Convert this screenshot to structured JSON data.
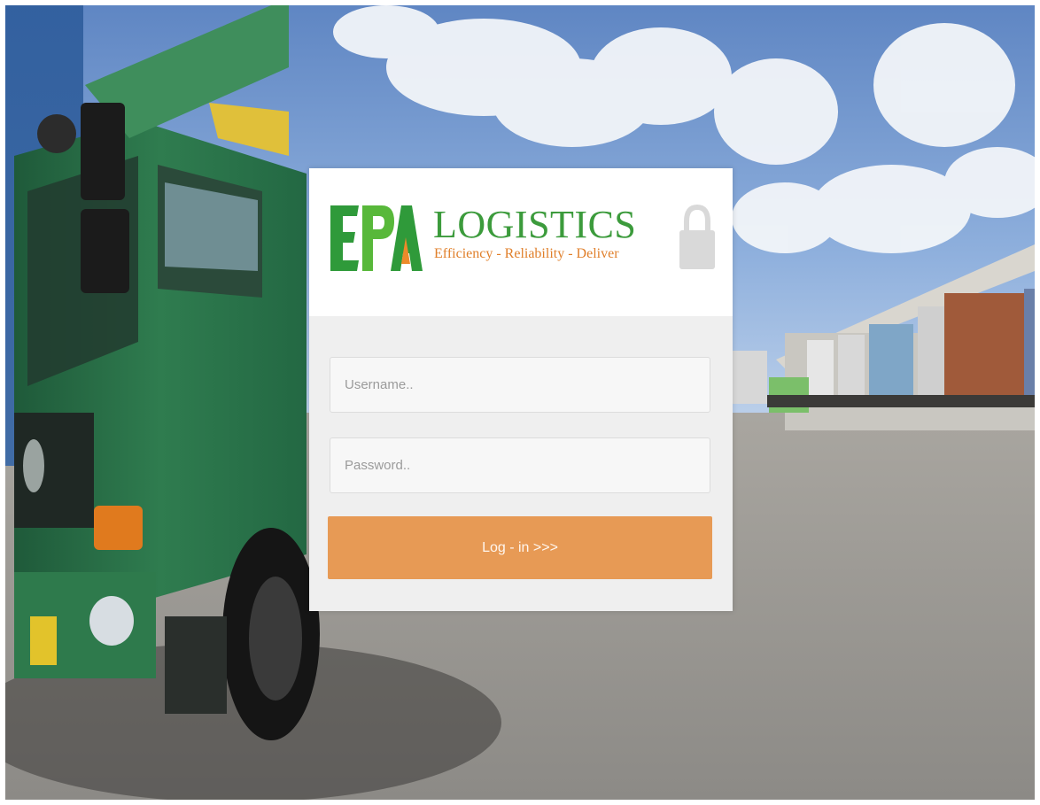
{
  "brand": {
    "mark": "EPA",
    "name": "LOGISTICS",
    "tagline": "Efficiency - Reliability - Deliver"
  },
  "form": {
    "username_placeholder": "Username..",
    "password_placeholder": "Password..",
    "username_value": "",
    "password_value": "",
    "submit_label": "Log - in >>>"
  },
  "icons": {
    "lock": "lock-icon"
  },
  "colors": {
    "brand_green": "#3c9b3c",
    "brand_orange": "#e07f2a",
    "button": "#e79a55",
    "panel_body": "#efefef",
    "lock": "#d9d9d9"
  }
}
